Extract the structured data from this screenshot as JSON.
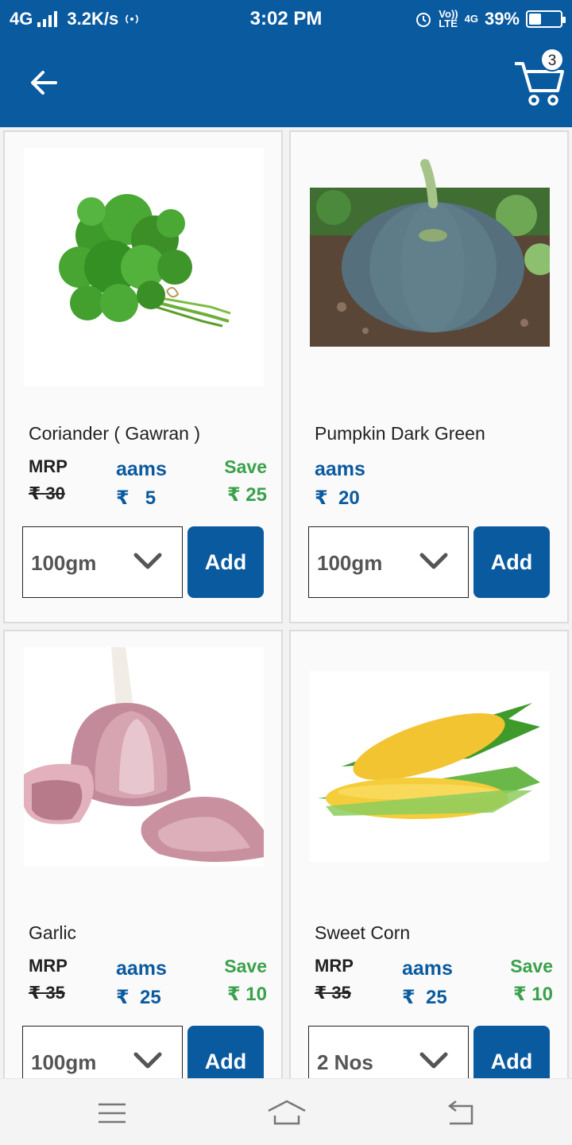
{
  "status_bar": {
    "network": "4G",
    "speed": "3.2K/s",
    "time": "3:02 PM",
    "volte_top": "Vo))",
    "volte_bottom": "LTE",
    "network2": "4G",
    "battery": "39%",
    "battery_level": 0.39
  },
  "header": {
    "back_icon": "arrow-left-icon",
    "cart_icon": "cart-icon",
    "cart_count": "3"
  },
  "products": [
    {
      "name": "Coriander ( Gawran )",
      "image": "coriander-image",
      "mrp_label": "MRP",
      "mrp": "₹ 30",
      "aams_label": "aams",
      "aams_price": "₹   5",
      "save_label": "Save",
      "save": "₹ 25",
      "qty": "100gm",
      "add_label": "Add"
    },
    {
      "name": "Pumpkin Dark Green",
      "image": "pumpkin-image",
      "aams_label": "aams",
      "aams_price": "₹  20",
      "qty": "100gm",
      "add_label": "Add"
    },
    {
      "name": "Garlic",
      "image": "garlic-image",
      "mrp_label": "MRP",
      "mrp": "₹ 35",
      "aams_label": "aams",
      "aams_price": "₹  25",
      "save_label": "Save",
      "save": "₹ 10",
      "qty": "100gm",
      "add_label": "Add"
    },
    {
      "name": "Sweet Corn",
      "image": "corn-image",
      "mrp_label": "MRP",
      "mrp": "₹ 35",
      "aams_label": "aams",
      "aams_price": "₹  25",
      "save_label": "Save",
      "save": "₹ 10",
      "qty": "2 Nos",
      "add_label": "Add"
    }
  ],
  "nav": {
    "menu_icon": "menu-icon",
    "home_icon": "home-icon",
    "back_icon": "back-icon"
  },
  "colors": {
    "primary": "#0a5aa0",
    "save_green": "#3aa14a"
  }
}
